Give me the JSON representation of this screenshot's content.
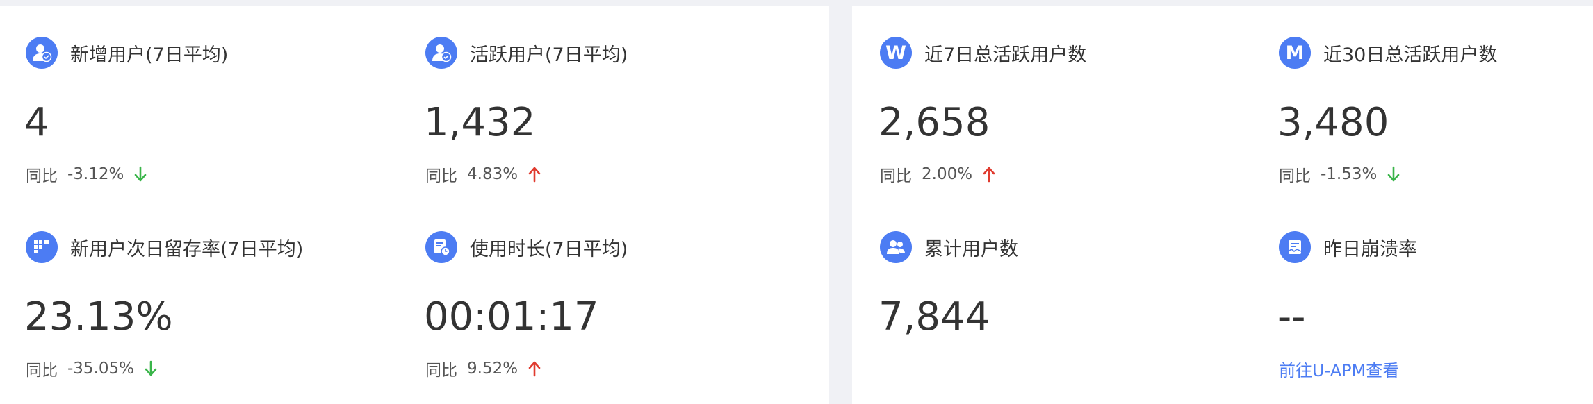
{
  "colors": {
    "accent": "#4c7cf3",
    "up": "#e03b2f",
    "down": "#3ab54a",
    "text": "#333333"
  },
  "left_panel": {
    "cards": [
      {
        "icon": "user-add-icon",
        "title": "新增用户(7日平均)",
        "value": "4",
        "compare_label": "同比",
        "compare_value": "-3.12%",
        "trend": "down"
      },
      {
        "icon": "user-active-icon",
        "title": "活跃用户(7日平均)",
        "value": "1,432",
        "compare_label": "同比",
        "compare_value": "4.83%",
        "trend": "up"
      },
      {
        "icon": "grid-retention-icon",
        "title": "新用户次日留存率(7日平均)",
        "value": "23.13%",
        "compare_label": "同比",
        "compare_value": "-35.05%",
        "trend": "down"
      },
      {
        "icon": "document-clock-icon",
        "title": "使用时长(7日平均)",
        "value": "00:01:17",
        "compare_label": "同比",
        "compare_value": "9.52%",
        "trend": "up"
      }
    ]
  },
  "right_panel": {
    "cards": [
      {
        "icon": "w-letter-icon",
        "icon_text": "W",
        "title": "近7日总活跃用户数",
        "value": "2,658",
        "compare_label": "同比",
        "compare_value": "2.00%",
        "trend": "up"
      },
      {
        "icon": "m-letter-icon",
        "icon_text": "M",
        "title": "近30日总活跃用户数",
        "value": "3,480",
        "compare_label": "同比",
        "compare_value": "-1.53%",
        "trend": "down"
      },
      {
        "icon": "users-group-icon",
        "title": "累计用户数",
        "value": "7,844"
      },
      {
        "icon": "crash-report-icon",
        "title": "昨日崩溃率",
        "value": "--",
        "link": "前往U-APM查看"
      }
    ]
  }
}
